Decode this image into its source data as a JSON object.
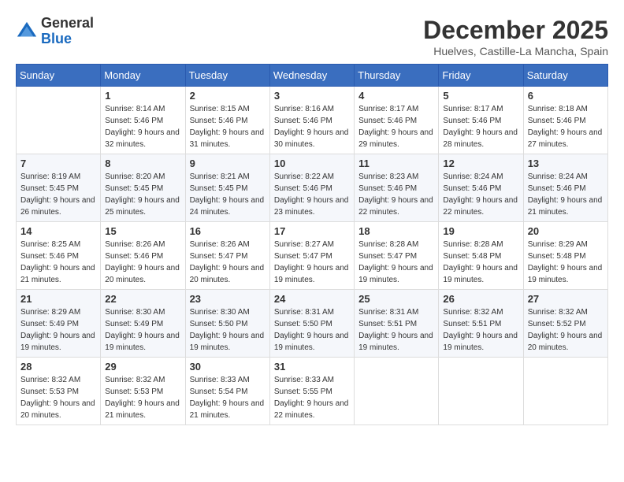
{
  "header": {
    "logo_general": "General",
    "logo_blue": "Blue",
    "month_title": "December 2025",
    "location": "Huelves, Castille-La Mancha, Spain"
  },
  "days_of_week": [
    "Sunday",
    "Monday",
    "Tuesday",
    "Wednesday",
    "Thursday",
    "Friday",
    "Saturday"
  ],
  "weeks": [
    [
      {
        "day": "",
        "sunrise": "",
        "sunset": "",
        "daylight": ""
      },
      {
        "day": "1",
        "sunrise": "Sunrise: 8:14 AM",
        "sunset": "Sunset: 5:46 PM",
        "daylight": "Daylight: 9 hours and 32 minutes."
      },
      {
        "day": "2",
        "sunrise": "Sunrise: 8:15 AM",
        "sunset": "Sunset: 5:46 PM",
        "daylight": "Daylight: 9 hours and 31 minutes."
      },
      {
        "day": "3",
        "sunrise": "Sunrise: 8:16 AM",
        "sunset": "Sunset: 5:46 PM",
        "daylight": "Daylight: 9 hours and 30 minutes."
      },
      {
        "day": "4",
        "sunrise": "Sunrise: 8:17 AM",
        "sunset": "Sunset: 5:46 PM",
        "daylight": "Daylight: 9 hours and 29 minutes."
      },
      {
        "day": "5",
        "sunrise": "Sunrise: 8:17 AM",
        "sunset": "Sunset: 5:46 PM",
        "daylight": "Daylight: 9 hours and 28 minutes."
      },
      {
        "day": "6",
        "sunrise": "Sunrise: 8:18 AM",
        "sunset": "Sunset: 5:46 PM",
        "daylight": "Daylight: 9 hours and 27 minutes."
      }
    ],
    [
      {
        "day": "7",
        "sunrise": "Sunrise: 8:19 AM",
        "sunset": "Sunset: 5:45 PM",
        "daylight": "Daylight: 9 hours and 26 minutes."
      },
      {
        "day": "8",
        "sunrise": "Sunrise: 8:20 AM",
        "sunset": "Sunset: 5:45 PM",
        "daylight": "Daylight: 9 hours and 25 minutes."
      },
      {
        "day": "9",
        "sunrise": "Sunrise: 8:21 AM",
        "sunset": "Sunset: 5:45 PM",
        "daylight": "Daylight: 9 hours and 24 minutes."
      },
      {
        "day": "10",
        "sunrise": "Sunrise: 8:22 AM",
        "sunset": "Sunset: 5:46 PM",
        "daylight": "Daylight: 9 hours and 23 minutes."
      },
      {
        "day": "11",
        "sunrise": "Sunrise: 8:23 AM",
        "sunset": "Sunset: 5:46 PM",
        "daylight": "Daylight: 9 hours and 22 minutes."
      },
      {
        "day": "12",
        "sunrise": "Sunrise: 8:24 AM",
        "sunset": "Sunset: 5:46 PM",
        "daylight": "Daylight: 9 hours and 22 minutes."
      },
      {
        "day": "13",
        "sunrise": "Sunrise: 8:24 AM",
        "sunset": "Sunset: 5:46 PM",
        "daylight": "Daylight: 9 hours and 21 minutes."
      }
    ],
    [
      {
        "day": "14",
        "sunrise": "Sunrise: 8:25 AM",
        "sunset": "Sunset: 5:46 PM",
        "daylight": "Daylight: 9 hours and 21 minutes."
      },
      {
        "day": "15",
        "sunrise": "Sunrise: 8:26 AM",
        "sunset": "Sunset: 5:46 PM",
        "daylight": "Daylight: 9 hours and 20 minutes."
      },
      {
        "day": "16",
        "sunrise": "Sunrise: 8:26 AM",
        "sunset": "Sunset: 5:47 PM",
        "daylight": "Daylight: 9 hours and 20 minutes."
      },
      {
        "day": "17",
        "sunrise": "Sunrise: 8:27 AM",
        "sunset": "Sunset: 5:47 PM",
        "daylight": "Daylight: 9 hours and 19 minutes."
      },
      {
        "day": "18",
        "sunrise": "Sunrise: 8:28 AM",
        "sunset": "Sunset: 5:47 PM",
        "daylight": "Daylight: 9 hours and 19 minutes."
      },
      {
        "day": "19",
        "sunrise": "Sunrise: 8:28 AM",
        "sunset": "Sunset: 5:48 PM",
        "daylight": "Daylight: 9 hours and 19 minutes."
      },
      {
        "day": "20",
        "sunrise": "Sunrise: 8:29 AM",
        "sunset": "Sunset: 5:48 PM",
        "daylight": "Daylight: 9 hours and 19 minutes."
      }
    ],
    [
      {
        "day": "21",
        "sunrise": "Sunrise: 8:29 AM",
        "sunset": "Sunset: 5:49 PM",
        "daylight": "Daylight: 9 hours and 19 minutes."
      },
      {
        "day": "22",
        "sunrise": "Sunrise: 8:30 AM",
        "sunset": "Sunset: 5:49 PM",
        "daylight": "Daylight: 9 hours and 19 minutes."
      },
      {
        "day": "23",
        "sunrise": "Sunrise: 8:30 AM",
        "sunset": "Sunset: 5:50 PM",
        "daylight": "Daylight: 9 hours and 19 minutes."
      },
      {
        "day": "24",
        "sunrise": "Sunrise: 8:31 AM",
        "sunset": "Sunset: 5:50 PM",
        "daylight": "Daylight: 9 hours and 19 minutes."
      },
      {
        "day": "25",
        "sunrise": "Sunrise: 8:31 AM",
        "sunset": "Sunset: 5:51 PM",
        "daylight": "Daylight: 9 hours and 19 minutes."
      },
      {
        "day": "26",
        "sunrise": "Sunrise: 8:32 AM",
        "sunset": "Sunset: 5:51 PM",
        "daylight": "Daylight: 9 hours and 19 minutes."
      },
      {
        "day": "27",
        "sunrise": "Sunrise: 8:32 AM",
        "sunset": "Sunset: 5:52 PM",
        "daylight": "Daylight: 9 hours and 20 minutes."
      }
    ],
    [
      {
        "day": "28",
        "sunrise": "Sunrise: 8:32 AM",
        "sunset": "Sunset: 5:53 PM",
        "daylight": "Daylight: 9 hours and 20 minutes."
      },
      {
        "day": "29",
        "sunrise": "Sunrise: 8:32 AM",
        "sunset": "Sunset: 5:53 PM",
        "daylight": "Daylight: 9 hours and 21 minutes."
      },
      {
        "day": "30",
        "sunrise": "Sunrise: 8:33 AM",
        "sunset": "Sunset: 5:54 PM",
        "daylight": "Daylight: 9 hours and 21 minutes."
      },
      {
        "day": "31",
        "sunrise": "Sunrise: 8:33 AM",
        "sunset": "Sunset: 5:55 PM",
        "daylight": "Daylight: 9 hours and 22 minutes."
      },
      {
        "day": "",
        "sunrise": "",
        "sunset": "",
        "daylight": ""
      },
      {
        "day": "",
        "sunrise": "",
        "sunset": "",
        "daylight": ""
      },
      {
        "day": "",
        "sunrise": "",
        "sunset": "",
        "daylight": ""
      }
    ]
  ]
}
